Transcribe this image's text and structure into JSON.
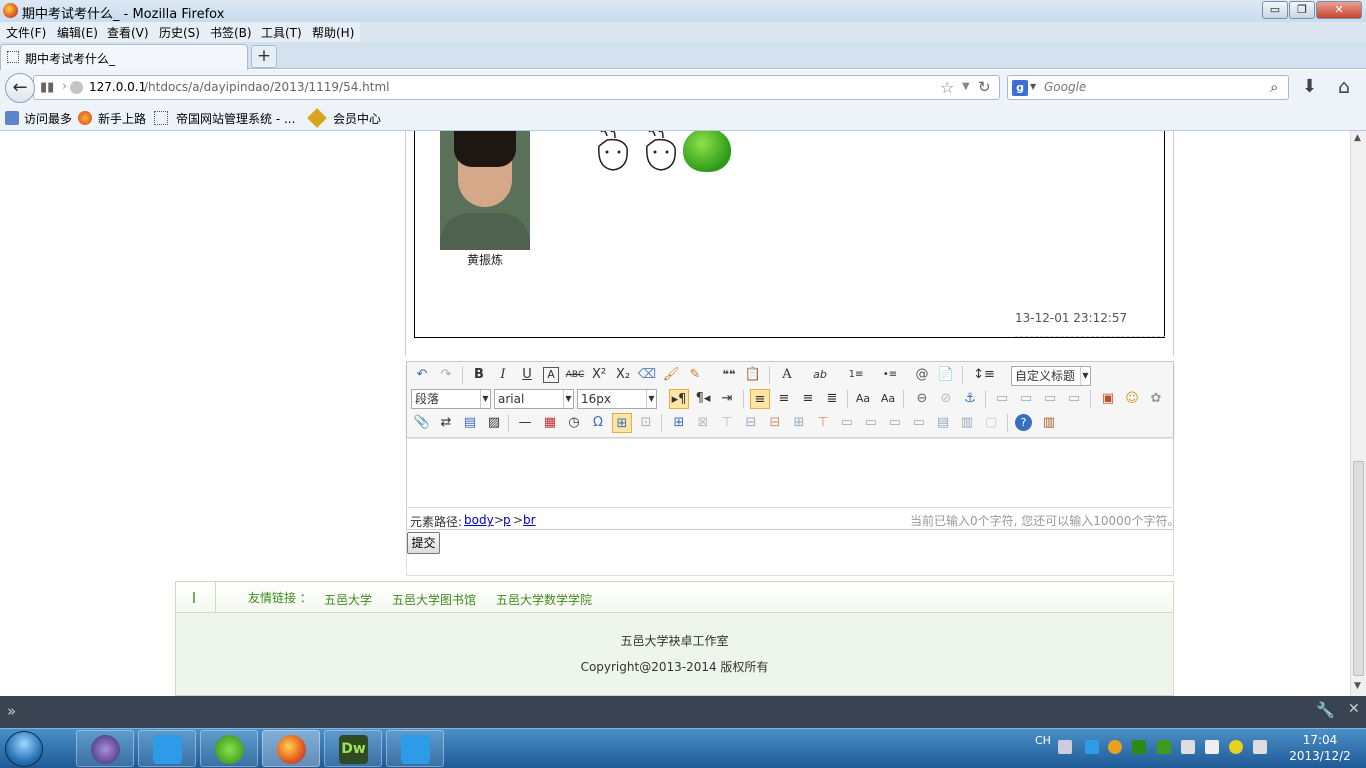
{
  "window": {
    "title": "期中考试考什么_ - Mozilla Firefox",
    "min_label": "▭",
    "max_label": "❐",
    "close_label": "✕"
  },
  "menu": [
    "文件(F)",
    "编辑(E)",
    "查看(V)",
    "历史(S)",
    "书签(B)",
    "工具(T)",
    "帮助(H)"
  ],
  "tab": {
    "label": "期中考试考什么_",
    "new_tab_label": "+"
  },
  "nav": {
    "back_icon": "←",
    "url_host": "127.0.0.1",
    "url_path": "/htdocs/a/dayipindao/2013/1119/54.html",
    "search_placeholder": "Google",
    "search_engine_letter": "g"
  },
  "bookmarks": [
    "访问最多",
    "新手上路",
    "帝国网站管理系统 - ...",
    "会员中心"
  ],
  "comment": {
    "username": "黄振炼",
    "time": "13-12-01 23:12:57"
  },
  "editor": {
    "toolbar_row1": [
      "↶",
      "↷",
      "B",
      "I",
      "U",
      "A",
      "ABC",
      "X²",
      "X₂",
      "⌫",
      "🖌",
      "✎",
      "❝❝",
      "📋",
      "A",
      "ab",
      "1≡",
      "•≡",
      "@",
      "📄",
      "↕≡"
    ],
    "custom_title": "自定义标题",
    "paragraph": "段落",
    "font_family": "arial",
    "font_size": "16px",
    "path_label": "元素路径:",
    "path": [
      "body",
      "p",
      "br"
    ],
    "char_count": "当前已输入0个字符, 您还可以输入10000个字符。",
    "submit_label": "提交"
  },
  "footer": {
    "links_label": "友情链接 ：",
    "links": [
      "五邑大学",
      "五邑大学图书馆",
      "五邑大学数学学院"
    ],
    "org": "五邑大学袂卓工作室",
    "copyright": "Copyright@2013-2014 版权所有"
  },
  "taskbar": {
    "lang": "CH",
    "time": "17:04",
    "date": "2013/12/2"
  }
}
